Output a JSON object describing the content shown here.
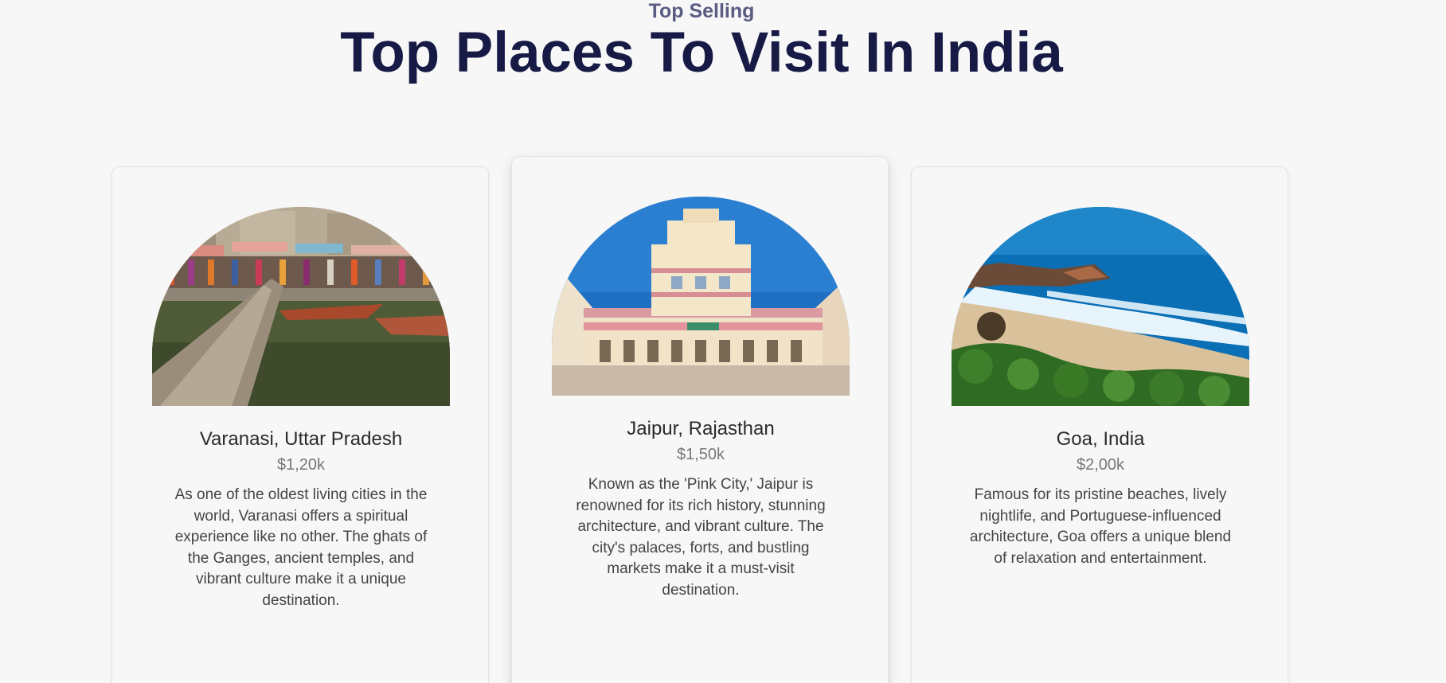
{
  "header": {
    "eyebrow": "Top Selling",
    "title": "Top Places To Visit In India"
  },
  "cards": [
    {
      "title": "Varanasi, Uttar Pradesh",
      "price": "$1,20k",
      "description": "As one of the oldest living cities in the world, Varanasi offers a spiritual experience like no other. The ghats of the Ganges, ancient temples, and vibrant culture make it a unique destination.",
      "image": "varanasi-ghats-boats-photo"
    },
    {
      "title": "Jaipur, Rajasthan",
      "price": "$1,50k",
      "description": "Known as the 'Pink City,' Jaipur is renowned for its rich history, stunning architecture, and vibrant culture. The city's palaces, forts, and bustling markets make it a must-visit destination.",
      "image": "jaipur-city-palace-photo"
    },
    {
      "title": "Goa, India",
      "price": "$2,00k",
      "description": "Famous for its pristine beaches, lively nightlife, and Portuguese-influenced architecture, Goa offers a unique blend of relaxation and entertainment.",
      "image": "goa-beach-coast-photo"
    }
  ],
  "colors": {
    "background": "#f7f7f7",
    "title": "#171a45",
    "eyebrow": "#5a5c83"
  }
}
